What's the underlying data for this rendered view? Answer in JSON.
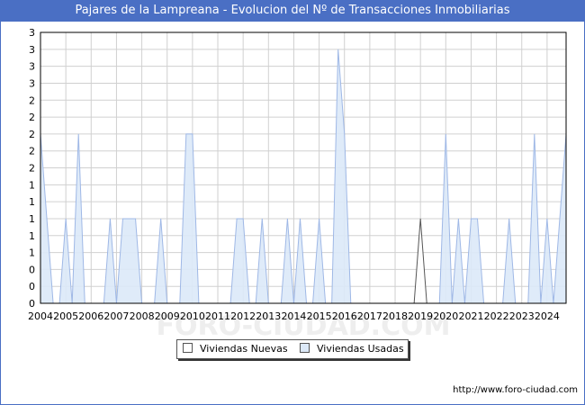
{
  "chart_data": {
    "type": "area",
    "title": "Pajares de la Lampreana - Evolucion del Nº de Transacciones Inmobiliarias",
    "xlabel": "",
    "ylabel": "",
    "x_tick_labels": [
      "2004",
      "2005",
      "2006",
      "2007",
      "2008",
      "2009",
      "2010",
      "2011",
      "2012",
      "2013",
      "2014",
      "2015",
      "2016",
      "2017",
      "2018",
      "2019",
      "2020",
      "2021",
      "2022",
      "2023",
      "2024"
    ],
    "y_tick_labels": [
      "0",
      "0",
      "0",
      "1",
      "1",
      "1",
      "1",
      "1",
      "2",
      "2",
      "2",
      "2",
      "2",
      "3",
      "3",
      "3",
      "3"
    ],
    "ylim": [
      0,
      3.2
    ],
    "xlim": [
      2004,
      2024.75
    ],
    "grid": true,
    "legend_position": "bottom-center",
    "series": [
      {
        "name": "Viviendas Nuevas",
        "color": "#ffffff",
        "stroke": "#555555",
        "points": [
          [
            2004.0,
            0
          ],
          [
            2018.75,
            0
          ],
          [
            2019.0,
            1
          ],
          [
            2019.25,
            0
          ],
          [
            2024.75,
            0
          ]
        ]
      },
      {
        "name": "Viviendas Usadas",
        "color": "#dce9f8",
        "stroke": "#9fb8e6",
        "points": [
          [
            2004.0,
            2
          ],
          [
            2004.25,
            1
          ],
          [
            2004.5,
            0
          ],
          [
            2004.75,
            0
          ],
          [
            2005.0,
            1
          ],
          [
            2005.25,
            0
          ],
          [
            2005.5,
            2
          ],
          [
            2005.75,
            0
          ],
          [
            2006.5,
            0
          ],
          [
            2006.75,
            1
          ],
          [
            2007.0,
            0
          ],
          [
            2007.25,
            1
          ],
          [
            2007.5,
            1
          ],
          [
            2007.75,
            1
          ],
          [
            2008.0,
            0
          ],
          [
            2008.5,
            0
          ],
          [
            2008.75,
            1
          ],
          [
            2009.0,
            0
          ],
          [
            2009.5,
            0
          ],
          [
            2009.75,
            2
          ],
          [
            2010.0,
            2
          ],
          [
            2010.25,
            0
          ],
          [
            2011.5,
            0
          ],
          [
            2011.75,
            1
          ],
          [
            2012.0,
            1
          ],
          [
            2012.25,
            0
          ],
          [
            2012.5,
            0
          ],
          [
            2012.75,
            1
          ],
          [
            2013.0,
            0
          ],
          [
            2013.5,
            0
          ],
          [
            2013.75,
            1
          ],
          [
            2014.0,
            0
          ],
          [
            2014.25,
            1
          ],
          [
            2014.5,
            0
          ],
          [
            2014.75,
            0
          ],
          [
            2015.0,
            1
          ],
          [
            2015.25,
            0
          ],
          [
            2015.5,
            0
          ],
          [
            2015.75,
            3
          ],
          [
            2016.0,
            2
          ],
          [
            2016.25,
            0
          ],
          [
            2019.75,
            0
          ],
          [
            2020.0,
            2
          ],
          [
            2020.25,
            0
          ],
          [
            2020.5,
            1
          ],
          [
            2020.75,
            0
          ],
          [
            2021.0,
            1
          ],
          [
            2021.25,
            1
          ],
          [
            2021.5,
            0
          ],
          [
            2022.25,
            0
          ],
          [
            2022.5,
            1
          ],
          [
            2022.75,
            0
          ],
          [
            2023.25,
            0
          ],
          [
            2023.5,
            2
          ],
          [
            2023.75,
            0
          ],
          [
            2024.0,
            1
          ],
          [
            2024.25,
            0
          ],
          [
            2024.75,
            2
          ]
        ]
      }
    ]
  },
  "credit": "http://www.foro-ciudad.com"
}
